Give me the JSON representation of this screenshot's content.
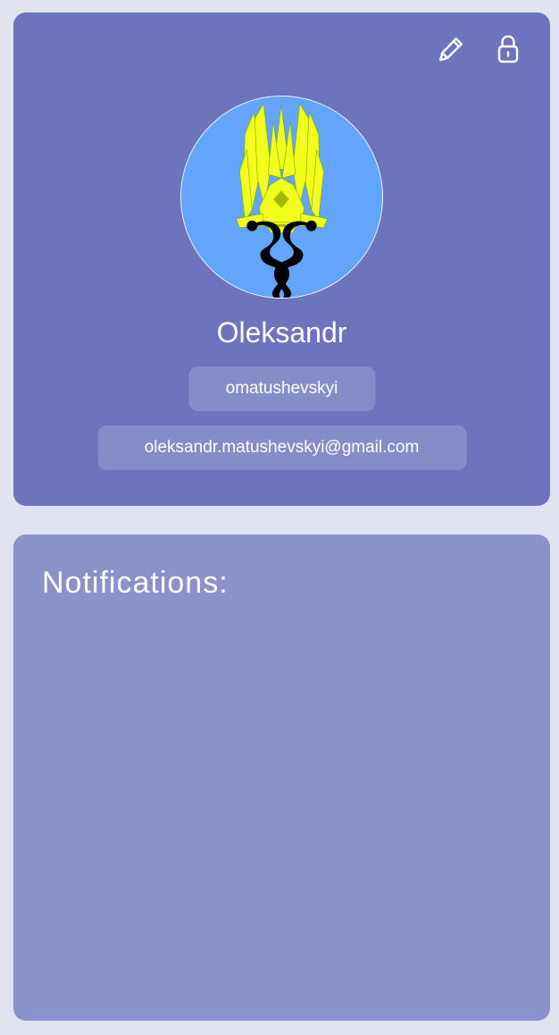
{
  "profile": {
    "name": "Oleksandr",
    "username": "omatushevskyi",
    "email": "oleksandr.matushevskyi@gmail.com",
    "avatar_icon": "emblem-avatar",
    "actions": {
      "edit_icon": "pencil-icon",
      "lock_icon": "lock-icon"
    }
  },
  "notifications": {
    "title": "Notifications:"
  },
  "colors": {
    "page_background": "#e2e3f1",
    "profile_card": "#6b74bd",
    "notifications_card": "#8b91c9",
    "avatar_background": "#62a5fb",
    "emblem_yellow": "#f2ff1c",
    "text": "#ffffff"
  }
}
